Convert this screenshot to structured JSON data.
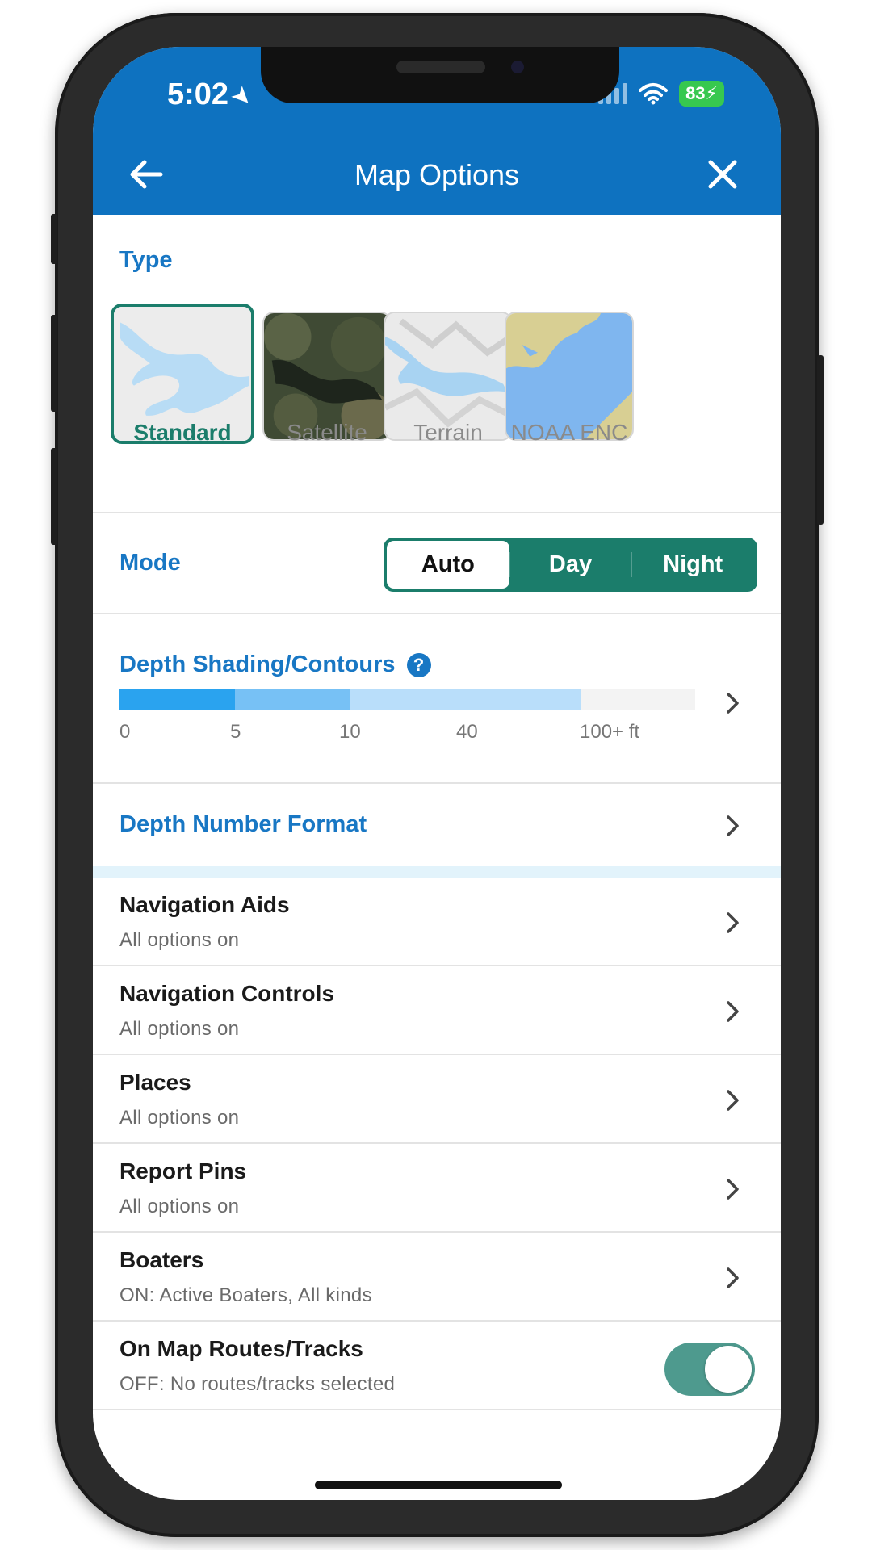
{
  "status_bar": {
    "time": "5:02",
    "battery": "83"
  },
  "header": {
    "title": "Map Options",
    "back_icon": "arrow-left-icon",
    "close_icon": "close-icon"
  },
  "type_section": {
    "title": "Type",
    "selected": "Standard",
    "options": [
      {
        "label": "Standard"
      },
      {
        "label": "Satellite"
      },
      {
        "label": "Terrain"
      },
      {
        "label": "NOAA ENC"
      }
    ]
  },
  "mode_section": {
    "title": "Mode",
    "selected": "Auto",
    "options": [
      "Auto",
      "Day",
      "Night"
    ]
  },
  "depth_section": {
    "title": "Depth Shading/Contours",
    "ticks": [
      "0",
      "5",
      "10",
      "40",
      "100+ ft"
    ],
    "band_colors": [
      "#2aa3ef",
      "#77c1f5",
      "#b9defa",
      "#f3f3f3"
    ]
  },
  "depth_format": {
    "title": "Depth Number Format"
  },
  "options_list": [
    {
      "title": "Navigation Aids",
      "subtitle": "All options on"
    },
    {
      "title": "Navigation Controls",
      "subtitle": "All options on"
    },
    {
      "title": "Places",
      "subtitle": "All options on"
    },
    {
      "title": "Report Pins",
      "subtitle": "All options on"
    },
    {
      "title": "Boaters",
      "subtitle": "ON: Active Boaters, All kinds"
    }
  ],
  "routes_row": {
    "title": "On Map Routes/Tracks",
    "subtitle": "OFF: No routes/tracks selected",
    "toggle_on": true
  },
  "colors": {
    "header": "#0e72c0",
    "accent_teal": "#1b7d6b",
    "link_blue": "#1877c4"
  }
}
